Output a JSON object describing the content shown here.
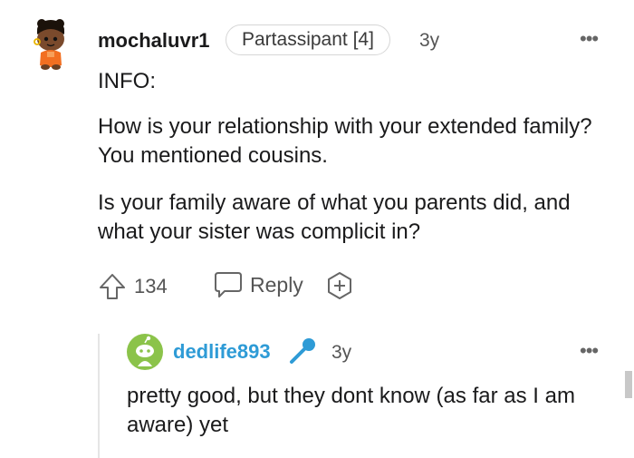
{
  "comment": {
    "author": "mochaluvr1",
    "flair": "Partassipant [4]",
    "age": "3y",
    "paragraphs": [
      "INFO:",
      "How is your relationship with your extended family? You mentioned cousins.",
      "Is your family aware of what you parents did, and what your sister was complicit in?"
    ],
    "score": "134",
    "reply_label": "Reply",
    "more_label": "•••"
  },
  "reply": {
    "author": "dedlife893",
    "age": "3y",
    "text": "pretty good, but they dont know (as far as I am aware) yet",
    "more_label": "•••"
  },
  "colors": {
    "reply_author": "#2e9bd6",
    "mic_icon": "#2e9bd6",
    "avatar2_bg": "#8bc34a"
  },
  "icons": {
    "avatar": "snoo-avatar-icon",
    "upvote": "upvote-arrow-icon",
    "reply": "speech-bubble-icon",
    "award": "award-plus-icon",
    "reply_avatar": "snoo-avatar-icon",
    "mic": "microphone-icon"
  }
}
